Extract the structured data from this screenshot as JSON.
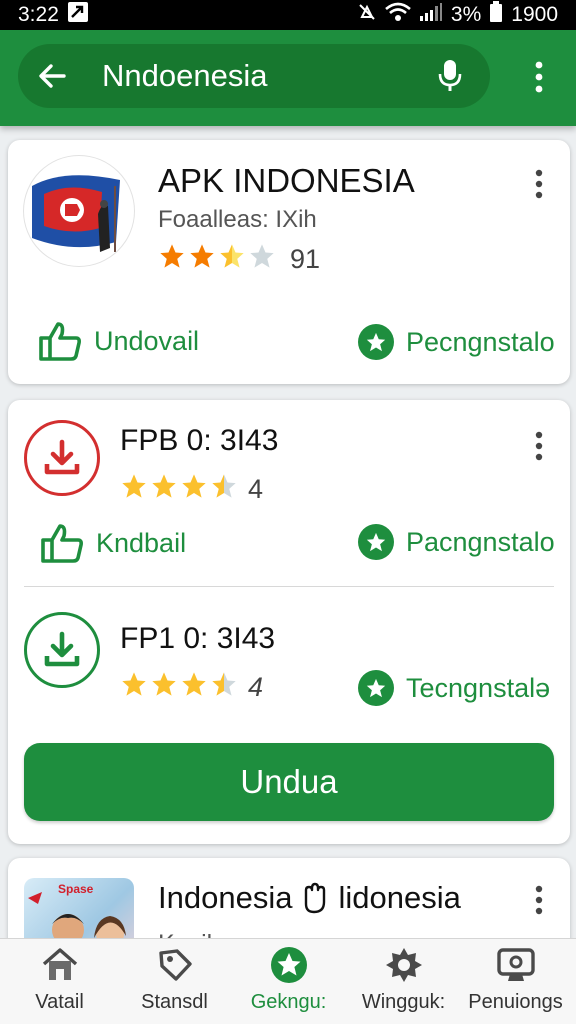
{
  "status_bar": {
    "time": "3:22",
    "battery": "3%",
    "clock_right": "1900"
  },
  "search": {
    "query": "Nndoenesia"
  },
  "colors": {
    "accent": "#1e8e3e",
    "accent_dark": "#17782f",
    "download_red": "#d32f2f",
    "star_orange": "#f57c00",
    "star_yellow": "#fbc02d",
    "star_empty": "#cfd8dc"
  },
  "cards": {
    "app1": {
      "title": "APK INDONESIA",
      "subtitle": "Foaalleas: IXih",
      "rating": 2.5,
      "count": "91",
      "action_left": "Undovail",
      "action_right": "Pecngnstalo"
    },
    "app2": {
      "title": "FPB 0: 3I43",
      "rating": 3.5,
      "count": "4",
      "action_left": "Kndbail",
      "action_right": "Pacngnstalo"
    },
    "app3": {
      "title": "FP1 0: 3I43",
      "rating": 3.5,
      "count": "4",
      "action_right": "Tecngnstalə"
    },
    "download_button": "Undua",
    "app4": {
      "title_a": "Indonesia",
      "title_b": "lidonesia",
      "subtitle": "Ksail",
      "thumb_text": "Spase"
    }
  },
  "bottom_nav": [
    {
      "label": "Vatail",
      "icon": "home-icon"
    },
    {
      "label": "Stansdl",
      "icon": "tag-icon"
    },
    {
      "label": "Gekngu:",
      "icon": "star-badge-icon",
      "active": true
    },
    {
      "label": "Wingguk:",
      "icon": "settings-icon"
    },
    {
      "label": "Penuiongs",
      "icon": "screen-icon"
    }
  ]
}
